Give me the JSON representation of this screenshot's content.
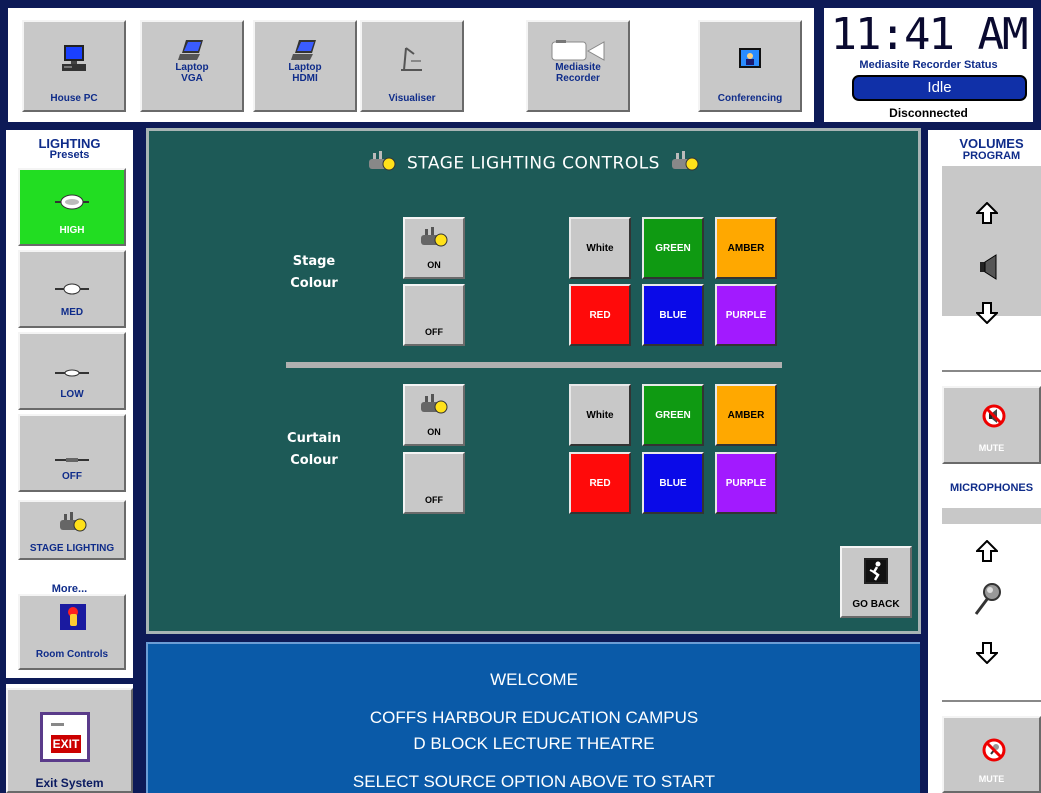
{
  "sources": [
    {
      "label": "House PC",
      "icon": "desktop-pc-icon"
    },
    {
      "label": "Laptop\nVGA",
      "icon": "laptop-icon"
    },
    {
      "label": "Laptop\nHDMI",
      "icon": "laptop-icon"
    },
    {
      "label": "Visualiser",
      "icon": "visualiser-icon"
    },
    {
      "label": "Mediasite\nRecorder",
      "icon": "camera-icon"
    },
    {
      "label": "Conferencing",
      "icon": "video-conference-icon"
    }
  ],
  "status": {
    "clock": "11:41 AM",
    "recorder_title": "Mediasite Recorder Status",
    "recorder_state": "Idle",
    "connection": "Disconnected"
  },
  "lighting": {
    "heading": "LIGHTING",
    "subheading": "Presets",
    "presets": [
      "HIGH",
      "MED",
      "LOW",
      "OFF"
    ],
    "active_color": "#22dd22",
    "stage_lighting": "STAGE LIGHTING",
    "more": "More...",
    "room_controls": "Room Controls"
  },
  "exit": {
    "label": "Exit System",
    "sign": "EXIT"
  },
  "main": {
    "title": "STAGE LIGHTING CONTROLS",
    "stage": {
      "label_line1": "Stage",
      "label_line2": "Colour",
      "on": "ON",
      "off": "OFF",
      "colours": [
        "White",
        "GREEN",
        "AMBER",
        "RED",
        "BLUE",
        "PURPLE"
      ]
    },
    "curtain": {
      "label_line1": "Curtain",
      "label_line2": "Colour",
      "on": "ON",
      "off": "OFF",
      "colours": [
        "White",
        "GREEN",
        "AMBER",
        "RED",
        "BLUE",
        "PURPLE"
      ]
    },
    "go_back": "GO BACK",
    "colour_hex": {
      "White": "#c8c8c8",
      "GREEN": "#0f9a12",
      "AMBER": "#ffa800",
      "RED": "#ff0a0a",
      "BLUE": "#0a0ae8",
      "PURPLE": "#a21aff"
    }
  },
  "volumes": {
    "heading": "VOLUMES",
    "program": "PROGRAM",
    "mute": "MUTE",
    "microphones": "MICROPHONES",
    "mic_mute": "MUTE"
  },
  "welcome": {
    "line1": "WELCOME",
    "line2": "COFFS HARBOUR EDUCATION CAMPUS",
    "line3": "D BLOCK LECTURE THEATRE",
    "line4": "SELECT SOURCE OPTION ABOVE TO START"
  }
}
